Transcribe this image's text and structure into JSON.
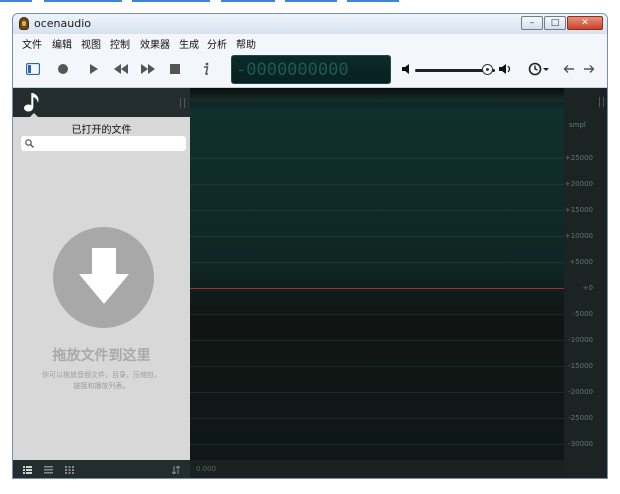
{
  "window": {
    "title": "ocenaudio",
    "minimize": "–",
    "maximize": "□",
    "close": "✕"
  },
  "menu": [
    "文件",
    "编辑",
    "视图",
    "控制",
    "效果器",
    "生成",
    "分析",
    "帮助"
  ],
  "toolbar": {
    "icons": [
      "sidebar-toggle-icon",
      "record-icon",
      "play-icon",
      "rewind-icon",
      "fast-forward-icon",
      "stop-icon",
      "info-icon"
    ],
    "time_display": "-0000000000",
    "volume_level_percent": 90
  },
  "sidebar": {
    "title": "已打开的文件",
    "search_placeholder": "",
    "drop_title": "拖放文件到这里",
    "drop_description": "你可以拖放音频文件，目录，压缩包，链接和播放列表。"
  },
  "waveform": {
    "time_label": "0.000",
    "unit_label": "smpl",
    "amplitude_labels": [
      "+25000",
      "+20000",
      "+15000",
      "+10000",
      "+5000",
      "+0",
      "-5000",
      "-10000",
      "-15000",
      "-20000",
      "-25000",
      "-30000"
    ]
  },
  "colors": {
    "accent": "#3b86d6",
    "waveform_background": "#0f2623",
    "center_line": "#b02a2a",
    "sidebar_background": "#d8d8d8"
  }
}
